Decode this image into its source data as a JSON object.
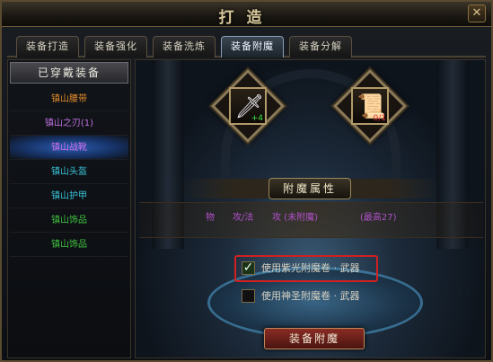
{
  "window": {
    "title": "打造",
    "close_icon": "close-icon"
  },
  "tabs": [
    {
      "label": "装备打造",
      "active": false
    },
    {
      "label": "装备强化",
      "active": false
    },
    {
      "label": "装备洗炼",
      "active": false
    },
    {
      "label": "装备附魔",
      "active": true
    },
    {
      "label": "装备分解",
      "active": false
    }
  ],
  "left_panel": {
    "header": "已穿戴装备",
    "items": [
      {
        "label": "镇山腰带",
        "color": "#e08a2a"
      },
      {
        "label": "镇山之刃(1)",
        "color": "#c070e0"
      },
      {
        "label": "镇山战靴",
        "color": "#d070f0",
        "selected": true
      },
      {
        "label": "镇山头盔",
        "color": "#39c4d8"
      },
      {
        "label": "镇山护甲",
        "color": "#39c4d8"
      },
      {
        "label": "镇山饰品",
        "color": "#40c040"
      },
      {
        "label": "镇山饰品",
        "color": "#40c040"
      }
    ]
  },
  "slots": {
    "equipment": {
      "icon": "sword-icon",
      "count": "+4"
    },
    "scroll": {
      "icon": "scroll-icon",
      "count": "0/1"
    }
  },
  "attributes": {
    "title": "附魔属性",
    "col1": "物",
    "col2": "攻/法",
    "col3": "攻 (未附魔)",
    "col4": "(最高27)"
  },
  "options": [
    {
      "label": "使用紫光附魔卷 · 武器",
      "checked": true
    },
    {
      "label": "使用神圣附魔卷 · 武器",
      "checked": false
    }
  ],
  "button": {
    "label": "装备附魔"
  }
}
